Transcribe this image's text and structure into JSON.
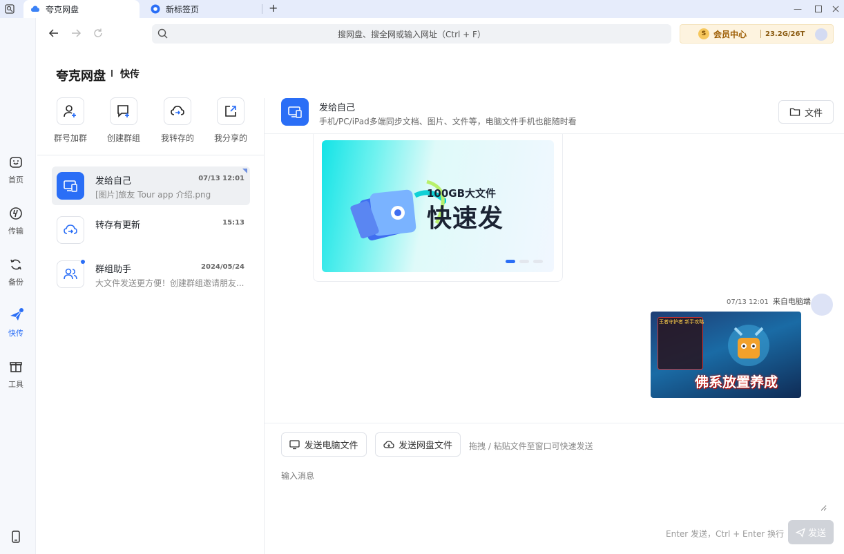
{
  "tabs": [
    {
      "label": "夸克网盘",
      "active": true
    },
    {
      "label": "新标签页",
      "active": false
    }
  ],
  "search": {
    "placeholder": "搜网盘、搜全网或输入网址（Ctrl + F）"
  },
  "vip": {
    "coin": "S",
    "label": "会员中心",
    "storage": "23.2G/26T"
  },
  "header": {
    "brand": "夸克网盘",
    "section": "快传"
  },
  "rail": [
    {
      "label": "首页",
      "icon": "home-smile-icon"
    },
    {
      "label": "传输",
      "icon": "transfer-icon"
    },
    {
      "label": "备份",
      "icon": "backup-icon"
    },
    {
      "label": "快传",
      "icon": "paper-plane-icon",
      "active": true
    },
    {
      "label": "工具",
      "icon": "gift-box-icon"
    }
  ],
  "quick_actions": [
    {
      "label": "群号加群",
      "icon": "add-user-icon"
    },
    {
      "label": "创建群组",
      "icon": "create-group-icon"
    },
    {
      "label": "我转存的",
      "icon": "cloud-transfer-icon"
    },
    {
      "label": "我分享的",
      "icon": "share-icon"
    }
  ],
  "conversations": [
    {
      "title": "发给自己",
      "time": "07/13 12:01",
      "subtitle": "[图片]旅友 Tour app 介绍.png",
      "selected": true
    },
    {
      "title": "转存有更新",
      "time": "15:13",
      "subtitle": ""
    },
    {
      "title": "群组助手",
      "time": "2024/05/24",
      "subtitle": "大文件发送更方便！创建群组邀请朋友..."
    }
  ],
  "chat": {
    "title": "发给自己",
    "description": "手机/PC/iPad多端同步文档、图片、文件等，电脑文件手机也能随时看",
    "files_button": "文件"
  },
  "banner": {
    "line1": "100GB大文件",
    "line2": "快速发"
  },
  "message": {
    "time": "07/13 12:01",
    "source": "来自电脑端",
    "image_title": "佛系放置养成",
    "image_panel_title": "王者守护者 新手攻略"
  },
  "composer": {
    "send_pc_file": "发送电脑文件",
    "send_cloud_file": "发送网盘文件",
    "drag_hint": "拖拽 / 粘贴文件至窗口可快速发送",
    "input_placeholder": "输入消息",
    "enter_hint": "Enter 发送，Ctrl + Enter 换行",
    "send_label": "发送"
  },
  "colors": {
    "accent": "#2a6ef6",
    "vip_bg": "#fdf3df",
    "disabled_send": "#d0d3d9"
  }
}
